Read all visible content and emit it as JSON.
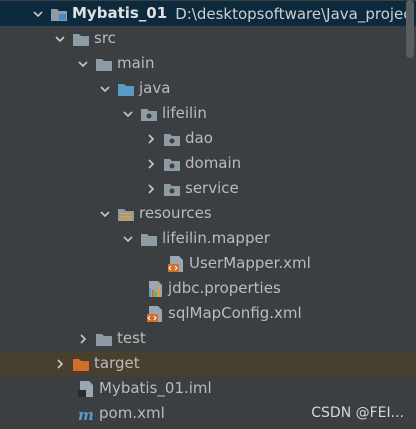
{
  "tree": {
    "root": {
      "name": "Mybatis_01",
      "path": "D:\\desktopsoftware\\Java_projec",
      "icon": "module-folder-icon"
    },
    "src": {
      "name": "src",
      "icon": "folder-icon"
    },
    "main": {
      "name": "main",
      "icon": "folder-icon"
    },
    "java": {
      "name": "java",
      "icon": "source-root-folder-icon"
    },
    "lifeilin": {
      "name": "lifeilin",
      "icon": "package-icon"
    },
    "dao": {
      "name": "dao",
      "icon": "package-icon"
    },
    "domain": {
      "name": "domain",
      "icon": "package-icon"
    },
    "service": {
      "name": "service",
      "icon": "package-icon"
    },
    "resources": {
      "name": "resources",
      "icon": "resources-root-folder-icon"
    },
    "lifeilin_mapper": {
      "name": "lifeilin.mapper",
      "icon": "folder-icon"
    },
    "usermapper_xml": {
      "name": "UserMapper.xml",
      "icon": "xml-file-icon"
    },
    "jdbc_properties": {
      "name": "jdbc.properties",
      "icon": "properties-file-icon"
    },
    "sqlmapconfig_xml": {
      "name": "sqlMapConfig.xml",
      "icon": "xml-file-icon"
    },
    "test": {
      "name": "test",
      "icon": "folder-icon"
    },
    "target": {
      "name": "target",
      "icon": "excluded-folder-icon"
    },
    "iml": {
      "name": "Mybatis_01.iml",
      "icon": "iml-file-icon"
    },
    "pom": {
      "name": "pom.xml",
      "icon": "maven-file-icon"
    }
  },
  "watermark": "CSDN @FEI...",
  "colors": {
    "background": "#3c3f41",
    "selected_row": "#0d293e",
    "highlight_row": "#48402f",
    "folder": "#8f9ba3",
    "source_root": "#5a9bc4",
    "excluded": "#d36e2a"
  }
}
